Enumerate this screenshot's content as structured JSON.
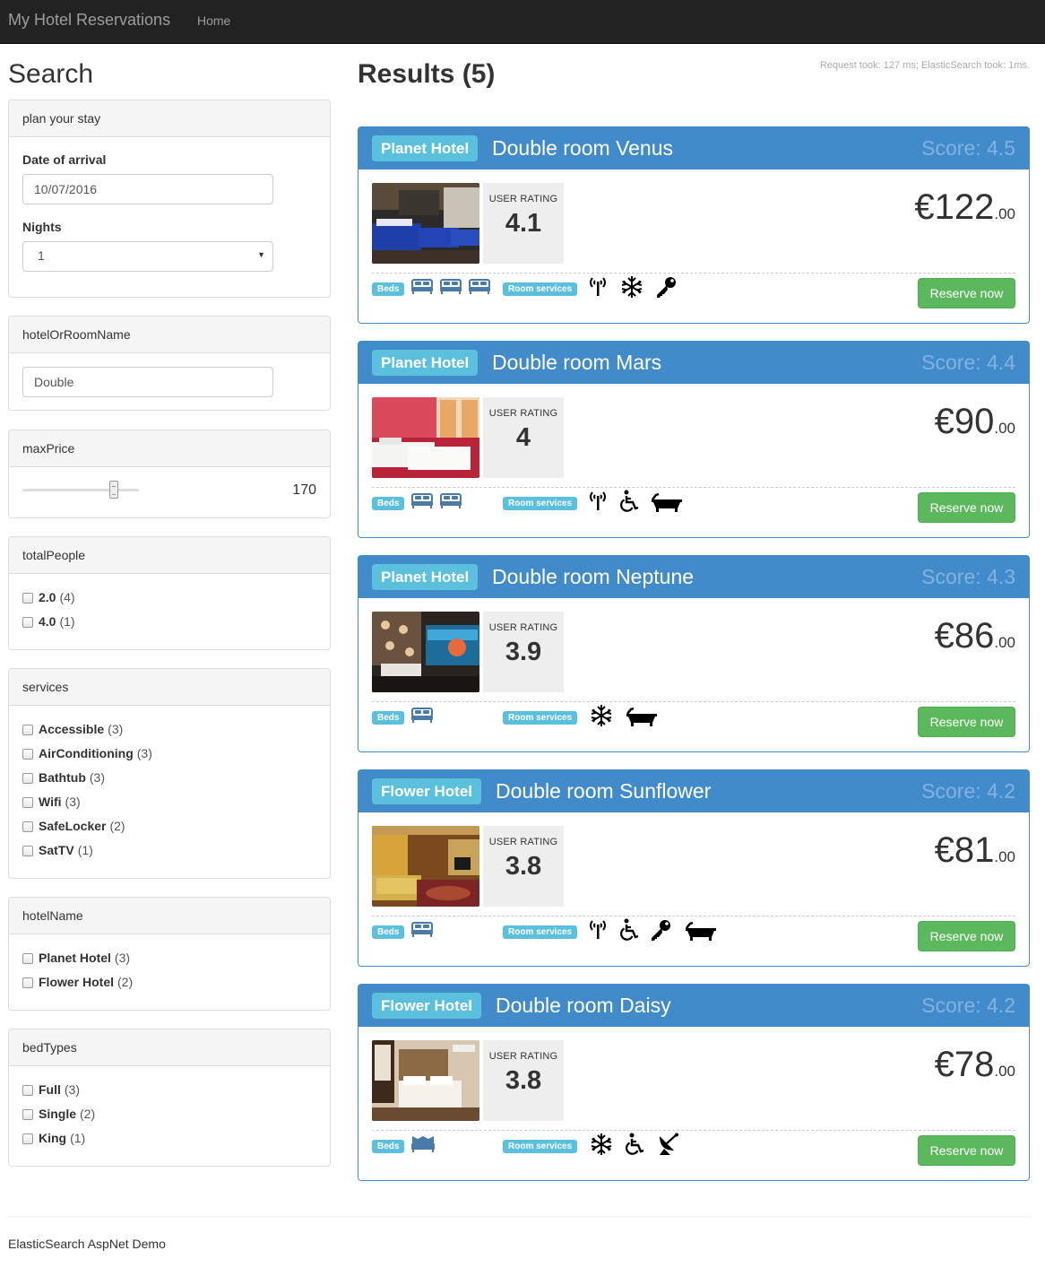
{
  "navbar": {
    "brand": "My Hotel Reservations",
    "home": "Home"
  },
  "search": {
    "title": "Search",
    "plan": {
      "heading": "plan your stay",
      "arrival_label": "Date of arrival",
      "arrival_value": "10/07/2016",
      "nights_label": "Nights",
      "nights_value": "1"
    },
    "name_filter": {
      "heading": "hotelOrRoomName",
      "value": "Double"
    },
    "max_price": {
      "heading": "maxPrice",
      "value": "170",
      "slider_fraction": 0.81
    },
    "total_people": {
      "heading": "totalPeople",
      "options": [
        {
          "name": "2.0",
          "count": "(4)"
        },
        {
          "name": "4.0",
          "count": "(1)"
        }
      ]
    },
    "services": {
      "heading": "services",
      "options": [
        {
          "name": "Accessible",
          "count": "(3)"
        },
        {
          "name": "AirConditioning",
          "count": "(3)"
        },
        {
          "name": "Bathtub",
          "count": "(3)"
        },
        {
          "name": "Wifi",
          "count": "(3)"
        },
        {
          "name": "SafeLocker",
          "count": "(2)"
        },
        {
          "name": "SatTV",
          "count": "(1)"
        }
      ]
    },
    "hotel_name": {
      "heading": "hotelName",
      "options": [
        {
          "name": "Planet Hotel",
          "count": "(3)"
        },
        {
          "name": "Flower Hotel",
          "count": "(2)"
        }
      ]
    },
    "bed_types": {
      "heading": "bedTypes",
      "options": [
        {
          "name": "Full",
          "count": "(3)"
        },
        {
          "name": "Single",
          "count": "(2)"
        },
        {
          "name": "King",
          "count": "(1)"
        }
      ]
    }
  },
  "results": {
    "title": "Results (5)",
    "timing": "Request took: 127 ms; ElasticSearch took: 1ms.",
    "rating_label": "USER RATING",
    "beds_tag": "Beds",
    "services_tag": "Room services",
    "reserve_label": "Reserve now",
    "items": [
      {
        "hotel": "Planet Hotel",
        "room": "Double room Venus",
        "score": "Score: 4.5",
        "rating": "4.1",
        "price": "€122",
        "cents": ".00"
      },
      {
        "hotel": "Planet Hotel",
        "room": "Double room Mars",
        "score": "Score: 4.4",
        "rating": "4",
        "price": "€90",
        "cents": ".00"
      },
      {
        "hotel": "Planet Hotel",
        "room": "Double room Neptune",
        "score": "Score: 4.3",
        "rating": "3.9",
        "price": "€86",
        "cents": ".00"
      },
      {
        "hotel": "Flower Hotel",
        "room": "Double room Sunflower",
        "score": "Score: 4.2",
        "rating": "3.8",
        "price": "€81",
        "cents": ".00"
      },
      {
        "hotel": "Flower Hotel",
        "room": "Double room Daisy",
        "score": "Score: 4.2",
        "rating": "3.8",
        "price": "€78",
        "cents": ".00"
      }
    ]
  },
  "footer": "ElasticSearch AspNet Demo"
}
